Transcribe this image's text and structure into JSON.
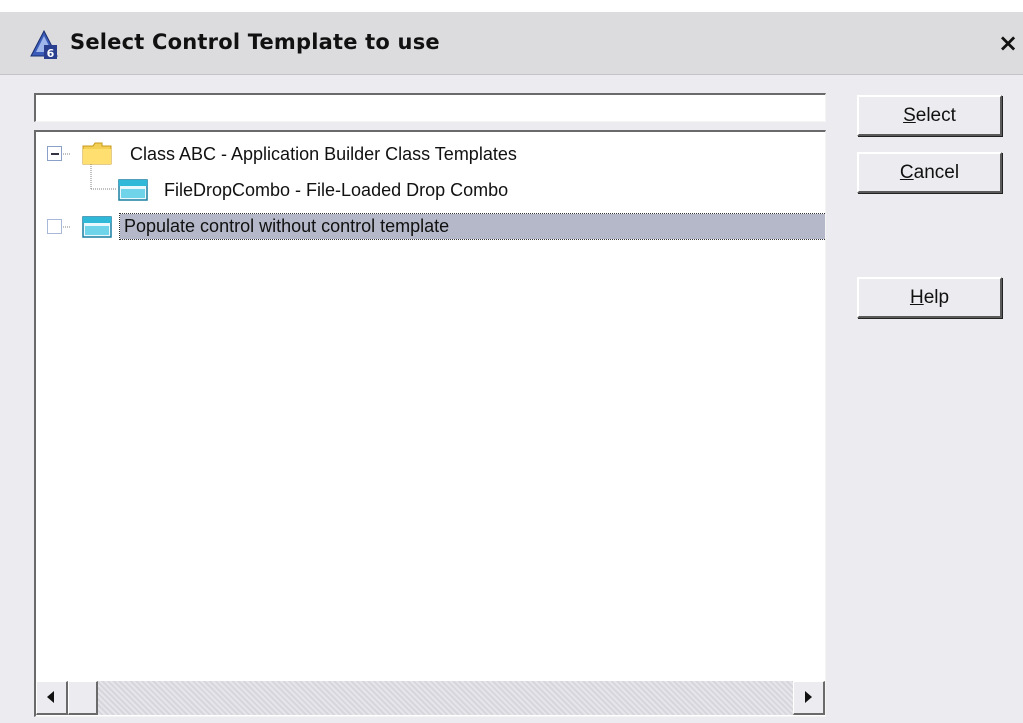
{
  "window": {
    "title": "Select Control Template to use",
    "close_label": "×"
  },
  "filter": {
    "value": ""
  },
  "tree": {
    "items": [
      {
        "label": "Class ABC - Application Builder Class Templates",
        "icon": "folder-icon",
        "expanded": true,
        "selected": false
      },
      {
        "label": "FileDropCombo - File-Loaded Drop Combo",
        "icon": "template-icon",
        "selected": false
      },
      {
        "label": "Populate control without control template",
        "icon": "template-icon",
        "selected": true
      }
    ]
  },
  "buttons": {
    "select": {
      "accel": "S",
      "rest": "elect"
    },
    "cancel": {
      "accel": "C",
      "rest": "ancel"
    },
    "help": {
      "accel": "H",
      "rest": "elp"
    }
  },
  "colors": {
    "selection": "#b4b8c8",
    "folder": "#f2c84b",
    "template_icon": "#2fb8d8"
  }
}
